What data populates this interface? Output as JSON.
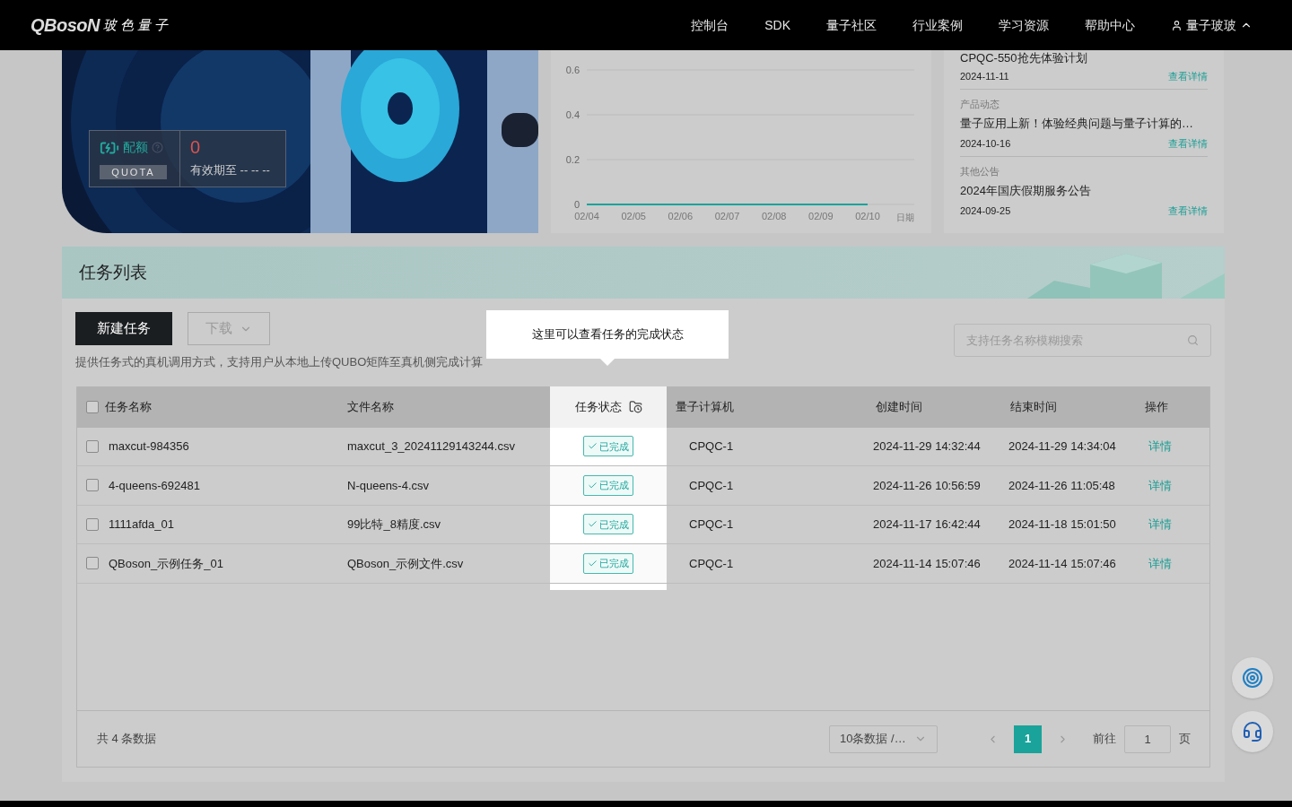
{
  "nav": {
    "logo_latin": "QBosoN",
    "logo_cn": "玻色量子",
    "items": [
      "控制台",
      "SDK",
      "量子社区",
      "行业案例",
      "学习资源",
      "帮助中心"
    ],
    "user": "量子玻玻"
  },
  "quota": {
    "label": "配额",
    "badge": "QUOTA",
    "value": "0",
    "expiry": "有效期至 -- -- --"
  },
  "chart": {
    "chart_data": {
      "type": "line",
      "xlabel": "日期",
      "x": [
        "02/04",
        "02/05",
        "02/06",
        "02/07",
        "02/08",
        "02/09",
        "02/10"
      ],
      "ylim": [
        0,
        0.6
      ],
      "yticks": [
        0,
        0.2,
        0.4,
        0.6
      ],
      "series": [
        {
          "color": "#1aa39a",
          "values": [
            0,
            0,
            0,
            0,
            0,
            0,
            0
          ]
        }
      ]
    }
  },
  "news": [
    {
      "title": "CPQC-550抢先体验计划",
      "date": "2024-11-11",
      "link": "查看详情"
    },
    {
      "category": "产品动态",
      "title": "量子应用上新！体验经典问题与量子计算的…",
      "date": "2024-10-16",
      "link": "查看详情"
    },
    {
      "category": "其他公告",
      "title": "2024年国庆假期服务公告",
      "date": "2024-09-25",
      "link": "查看详情"
    }
  ],
  "tasks": {
    "title": "任务列表",
    "new_button": "新建任务",
    "download_button": "下载",
    "description": "提供任务式的真机调用方式，支持用户从本地上传QUBO矩阵至真机侧完成计算",
    "search": {
      "placeholder": "支持任务名称模糊搜索"
    },
    "tooltip": "这里可以查看任务的完成状态",
    "columns": [
      "任务名称",
      "文件名称",
      "任务状态",
      "量子计算机",
      "创建时间",
      "结束时间",
      "操作"
    ],
    "header_checked": false,
    "rows": [
      {
        "checked": false,
        "name": "maxcut-984356",
        "file": "maxcut_3_20241129143244.csv",
        "status": "已完成",
        "computer": "CPQC-1",
        "created": "2024-11-29 14:32:44",
        "ended": "2024-11-29 14:34:04",
        "action": "详情"
      },
      {
        "checked": false,
        "name": "4-queens-692481",
        "file": "N-queens-4.csv",
        "status": "已完成",
        "computer": "CPQC-1",
        "created": "2024-11-26 10:56:59",
        "ended": "2024-11-26 11:05:48",
        "action": "详情"
      },
      {
        "checked": false,
        "name": "1111afda_01",
        "file": "99比特_8精度.csv",
        "status": "已完成",
        "computer": "CPQC-1",
        "created": "2024-11-17 16:42:44",
        "ended": "2024-11-18 15:01:50",
        "action": "详情"
      },
      {
        "checked": false,
        "name": "QBoson_示例任务_01",
        "file": "QBoson_示例文件.csv",
        "status": "已完成",
        "computer": "CPQC-1",
        "created": "2024-11-14 15:07:46",
        "ended": "2024-11-14 15:07:46",
        "action": "详情"
      }
    ],
    "total": "共 4 条数据",
    "page_size": "10条数据 /…",
    "pages": [
      {
        "label": "1",
        "selected": true
      }
    ],
    "goto_label": "前往",
    "goto_value": "1",
    "page_unit": "页"
  }
}
